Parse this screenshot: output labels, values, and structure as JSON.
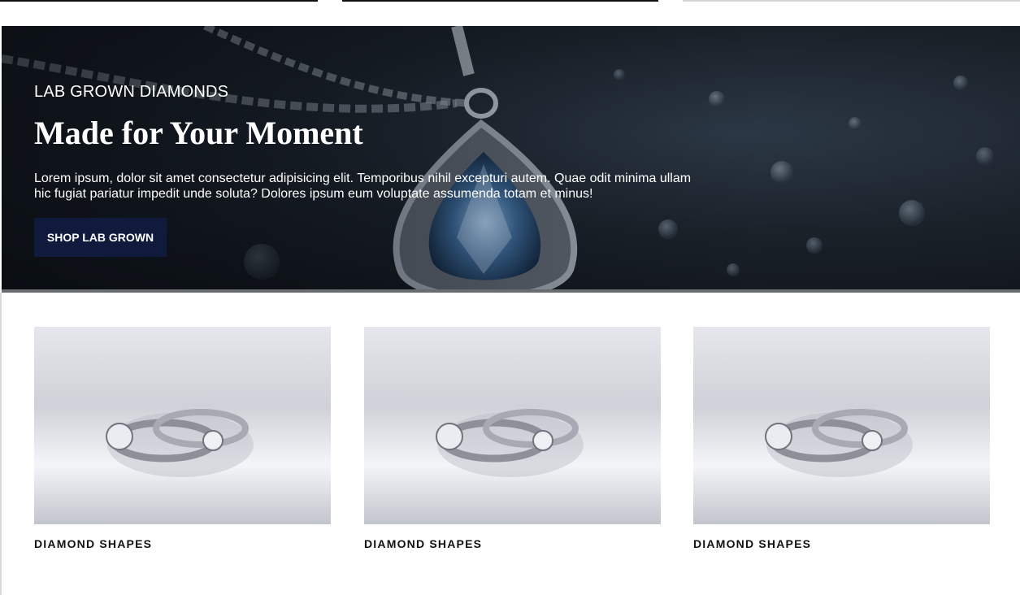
{
  "hero": {
    "eyebrow": "LAB GROWN DIAMONDS",
    "headline": "Made for Your Moment",
    "description": "Lorem ipsum, dolor sit amet consectetur adipisicing elit. Temporibus nihil excepturi autem. Quae odit minima ullam hic fugiat pariatur impedit unde soluta? Dolores ipsum eum voluptate assumenda totam et minus!",
    "cta_label": "SHOP LAB GROWN",
    "image": "blue-diamond-pendant-photo"
  },
  "cards": [
    {
      "label": "DIAMOND SHAPES",
      "image": "diamond-rings-photo"
    },
    {
      "label": "DIAMOND SHAPES",
      "image": "diamond-rings-photo"
    },
    {
      "label": "DIAMOND SHAPES",
      "image": "diamond-rings-photo"
    }
  ],
  "colors": {
    "button_bg": "#0f1a3c",
    "text": "#111111"
  }
}
